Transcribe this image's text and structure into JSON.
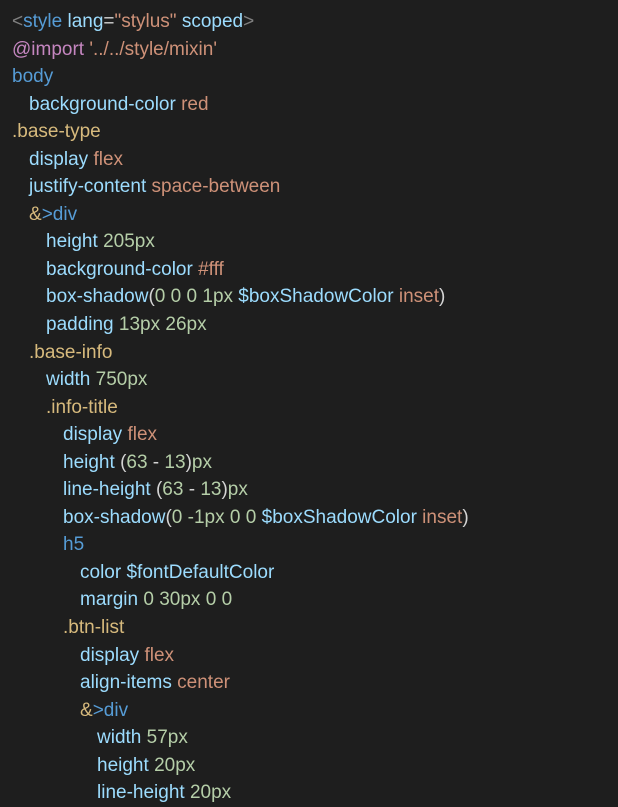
{
  "line1": {
    "lt": "<",
    "tag": "style",
    "attr": "lang",
    "eq": "=",
    "val": "\"stylus\"",
    "scoped": "scoped",
    "gt": ">"
  },
  "line2": {
    "at": "@import",
    "path": "'../../style/mixin'"
  },
  "line3": {
    "sel": "body"
  },
  "line4": {
    "prop": "background-color",
    "val": "red"
  },
  "line5": {
    "sel": ".base-type"
  },
  "line6": {
    "prop": "display",
    "val": "flex"
  },
  "line7": {
    "prop": "justify-content",
    "val": "space-between"
  },
  "line8": {
    "amp": "&",
    "child": ">div"
  },
  "line9": {
    "prop": "height",
    "num": "205",
    "unit": "px"
  },
  "line10": {
    "prop": "background-color",
    "hex": "#fff"
  },
  "line11": {
    "prop": "box-shadow",
    "n1": "0",
    "n2": "0",
    "n3": "0",
    "n4": "1",
    "px": "px",
    "var": "$boxShadowColor",
    "inset": "inset"
  },
  "line12": {
    "prop": "padding",
    "n1": "13",
    "px1": "px",
    "n2": "26",
    "px2": "px"
  },
  "line13": {
    "sel": ".base-info"
  },
  "line14": {
    "prop": "width",
    "num": "750",
    "unit": "px"
  },
  "line15": {
    "sel": ".info-title"
  },
  "line16": {
    "prop": "display",
    "val": "flex"
  },
  "line17": {
    "prop": "height",
    "lp": "(",
    "n1": "63",
    "minus": " - ",
    "n2": "13",
    "rp": ")",
    "unit": "px"
  },
  "line18": {
    "prop": "line-height",
    "lp": "(",
    "n1": "63",
    "minus": " - ",
    "n2": "13",
    "rp": ")",
    "unit": "px"
  },
  "line19": {
    "prop": "box-shadow",
    "n1": "0",
    "n2": "-1",
    "px": "px",
    "n3": "0",
    "n4": "0",
    "var": "$boxShadowColor",
    "inset": "inset"
  },
  "line20": {
    "sel": "h5"
  },
  "line21": {
    "prop": "color",
    "var": "$fontDefaultColor"
  },
  "line22": {
    "prop": "margin",
    "n1": "0",
    "n2": "30",
    "px": "px",
    "n3": "0",
    "n4": "0"
  },
  "line23": {
    "sel": ".btn-list"
  },
  "line24": {
    "prop": "display",
    "val": "flex"
  },
  "line25": {
    "prop": "align-items",
    "val": "center"
  },
  "line26": {
    "amp": "&",
    "child": ">div"
  },
  "line27": {
    "prop": "width",
    "num": "57",
    "unit": "px"
  },
  "line28": {
    "prop": "height",
    "num": "20",
    "unit": "px"
  },
  "line29": {
    "prop": "line-height",
    "num": "20",
    "unit": "px"
  }
}
